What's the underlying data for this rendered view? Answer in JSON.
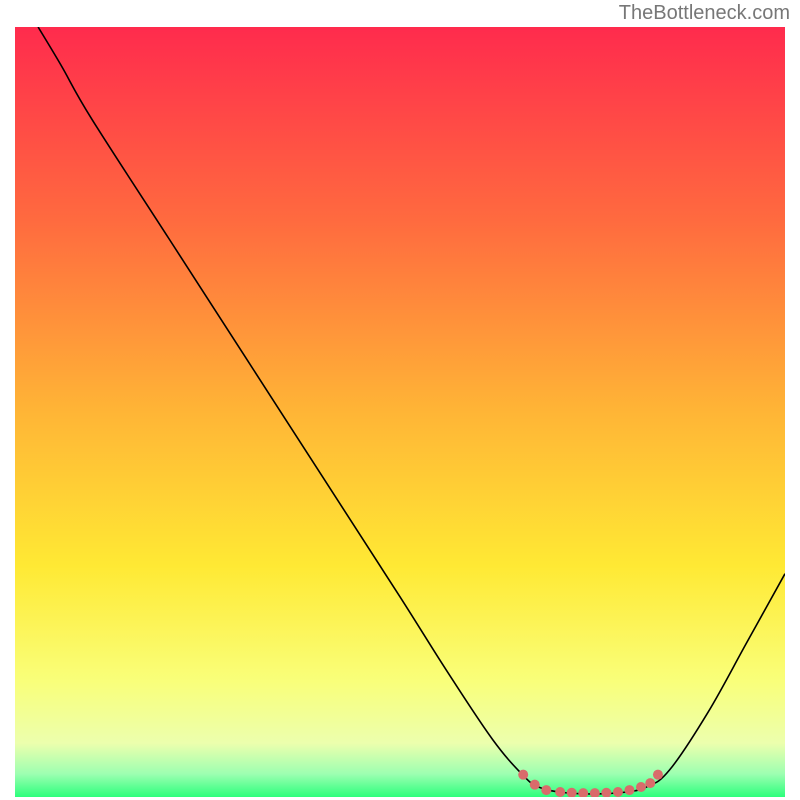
{
  "watermark": "TheBottleneck.com",
  "chart_data": {
    "type": "line",
    "title": "",
    "xlabel": "",
    "ylabel": "",
    "xlim": [
      0,
      100
    ],
    "ylim": [
      0,
      100
    ],
    "background_gradient": {
      "stops": [
        {
          "offset": 0,
          "color": "#ff2b4d"
        },
        {
          "offset": 25,
          "color": "#ff6a3f"
        },
        {
          "offset": 50,
          "color": "#ffb536"
        },
        {
          "offset": 70,
          "color": "#ffe934"
        },
        {
          "offset": 85,
          "color": "#f9ff7a"
        },
        {
          "offset": 93,
          "color": "#ecffad"
        },
        {
          "offset": 97,
          "color": "#9dffb1"
        },
        {
          "offset": 100,
          "color": "#2cff7c"
        }
      ]
    },
    "series": [
      {
        "name": "curve",
        "type": "line",
        "color": "#000000",
        "stroke_width": 1.6,
        "points": [
          {
            "x": 3,
            "y": 100
          },
          {
            "x": 6,
            "y": 95
          },
          {
            "x": 10,
            "y": 88
          },
          {
            "x": 20,
            "y": 72.5
          },
          {
            "x": 30,
            "y": 57
          },
          {
            "x": 40,
            "y": 41.5
          },
          {
            "x": 50,
            "y": 26
          },
          {
            "x": 56,
            "y": 16.5
          },
          {
            "x": 62,
            "y": 7.5
          },
          {
            "x": 66,
            "y": 2.8
          },
          {
            "x": 68,
            "y": 1.3
          },
          {
            "x": 71,
            "y": 0.6
          },
          {
            "x": 75,
            "y": 0.4
          },
          {
            "x": 79,
            "y": 0.6
          },
          {
            "x": 82,
            "y": 1.3
          },
          {
            "x": 85,
            "y": 3.5
          },
          {
            "x": 90,
            "y": 11
          },
          {
            "x": 95,
            "y": 20
          },
          {
            "x": 100,
            "y": 29
          }
        ]
      },
      {
        "name": "highlight-dots",
        "type": "scatter",
        "color": "#d96b6b",
        "radius": 5,
        "points": [
          {
            "x": 66.0,
            "y": 2.9
          },
          {
            "x": 67.5,
            "y": 1.6
          },
          {
            "x": 69.0,
            "y": 0.9
          },
          {
            "x": 70.8,
            "y": 0.65
          },
          {
            "x": 72.3,
            "y": 0.55
          },
          {
            "x": 73.8,
            "y": 0.5
          },
          {
            "x": 75.3,
            "y": 0.5
          },
          {
            "x": 76.8,
            "y": 0.55
          },
          {
            "x": 78.3,
            "y": 0.65
          },
          {
            "x": 79.8,
            "y": 0.9
          },
          {
            "x": 81.3,
            "y": 1.3
          },
          {
            "x": 82.5,
            "y": 1.8
          },
          {
            "x": 83.5,
            "y": 2.9
          }
        ]
      }
    ]
  }
}
